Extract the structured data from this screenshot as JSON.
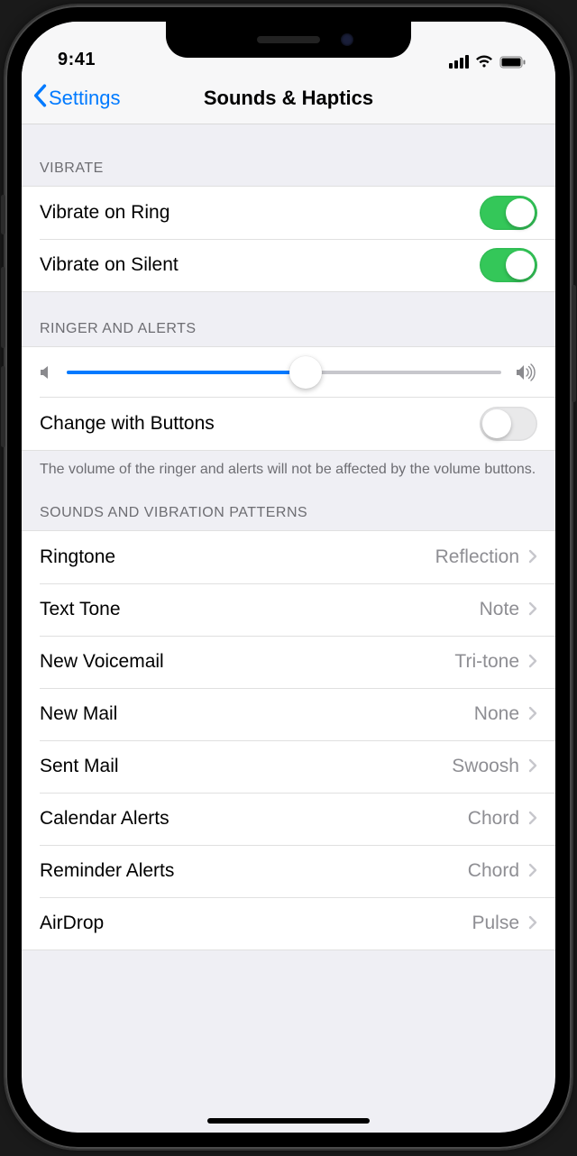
{
  "status": {
    "time": "9:41"
  },
  "nav": {
    "back_label": "Settings",
    "title": "Sounds & Haptics"
  },
  "sections": {
    "vibrate": {
      "header": "VIBRATE",
      "vibrate_on_ring": {
        "label": "Vibrate on Ring",
        "value": true
      },
      "vibrate_on_silent": {
        "label": "Vibrate on Silent",
        "value": true
      }
    },
    "ringer": {
      "header": "RINGER AND ALERTS",
      "volume_percent": 55,
      "change_with_buttons": {
        "label": "Change with Buttons",
        "value": false
      },
      "footer": "The volume of the ringer and alerts will not be affected by the volume buttons."
    },
    "patterns": {
      "header": "SOUNDS AND VIBRATION PATTERNS",
      "items": [
        {
          "label": "Ringtone",
          "value": "Reflection"
        },
        {
          "label": "Text Tone",
          "value": "Note"
        },
        {
          "label": "New Voicemail",
          "value": "Tri-tone"
        },
        {
          "label": "New Mail",
          "value": "None"
        },
        {
          "label": "Sent Mail",
          "value": "Swoosh"
        },
        {
          "label": "Calendar Alerts",
          "value": "Chord"
        },
        {
          "label": "Reminder Alerts",
          "value": "Chord"
        },
        {
          "label": "AirDrop",
          "value": "Pulse"
        }
      ]
    }
  }
}
